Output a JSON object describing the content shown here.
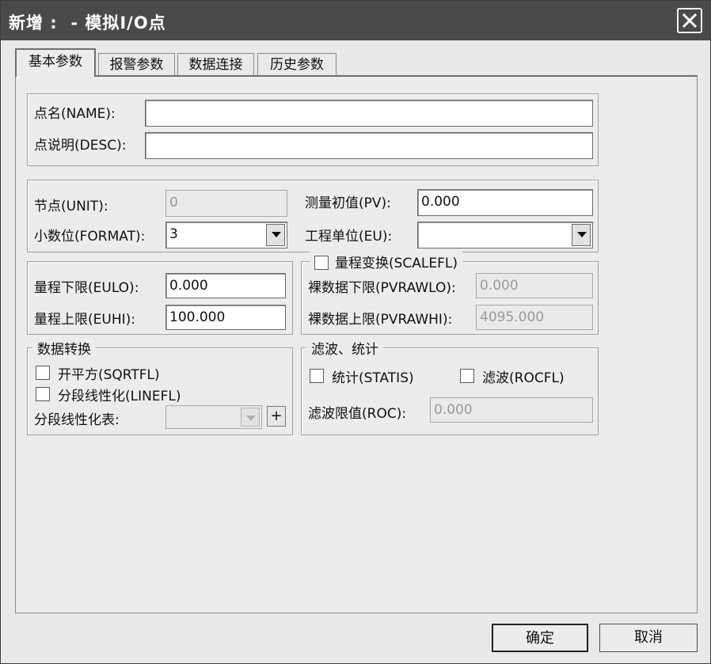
{
  "window": {
    "title": "新增 :  - 模拟I/O点"
  },
  "tabs": [
    {
      "label": "基本参数"
    },
    {
      "label": "报警参数"
    },
    {
      "label": "数据连接"
    },
    {
      "label": "历史参数"
    }
  ],
  "basic": {
    "name_label": "点名(NAME):",
    "name_value": "",
    "desc_label": "点说明(DESC):",
    "desc_value": ""
  },
  "unit_group": {
    "unit_label": "节点(UNIT):",
    "unit_value": "0",
    "pv_label": "测量初值(PV):",
    "pv_value": "0.000",
    "format_label": "小数位(FORMAT):",
    "format_value": "3",
    "eu_label": "工程单位(EU):",
    "eu_value": ""
  },
  "range_group": {
    "eulo_label": "量程下限(EULO):",
    "eulo_value": "0.000",
    "euhi_label": "量程上限(EUHI):",
    "euhi_value": "100.000"
  },
  "scale_group": {
    "legend": "量程变换(SCALEFL)",
    "checked": false,
    "pvrawlo_label": "裸数据下限(PVRAWLO):",
    "pvrawlo_value": "0.000",
    "pvrawhi_label": "裸数据上限(PVRAWHI):",
    "pvrawhi_value": "4095.000"
  },
  "convert_group": {
    "legend": "数据转换",
    "sqrt_label": "开平方(SQRTFL)",
    "sqrt_checked": false,
    "linefl_label": "分段线性化(LINEFL)",
    "linefl_checked": false,
    "table_label": "分段线性化表:",
    "table_value": "",
    "plus_label": "+"
  },
  "filter_group": {
    "legend": "滤波、统计",
    "statis_label": "统计(STATIS)",
    "statis_checked": false,
    "rocfl_label": "滤波(ROCFL)",
    "rocfl_checked": false,
    "roc_label": "滤波限值(ROC):",
    "roc_value": "0.000"
  },
  "buttons": {
    "ok": "确定",
    "cancel": "取消"
  },
  "icons": {
    "close": "close-icon",
    "dropdown": "chevron-down-icon"
  }
}
